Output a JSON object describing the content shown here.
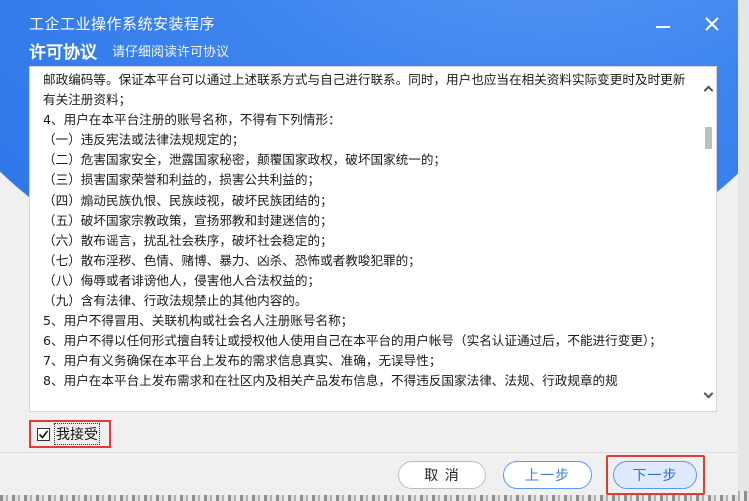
{
  "window": {
    "app_title": "工企工业操作系统安装程序",
    "section_title": "许可协议",
    "section_subtitle": "请仔细阅读许可协议",
    "minimize_symbol": "—",
    "close_symbol": "✕"
  },
  "license": {
    "paragraphs": [
      "邮政编码等。保证本平台可以通过上述联系方式与自己进行联系。同时，用户也应当在相关资料实际变更时及时更新有关注册资料；",
      "4、用户在本平台注册的账号名称，不得有下列情形：",
      "（一）违反宪法或法律法规规定的；",
      "（二）危害国家安全，泄露国家秘密，颠覆国家政权，破坏国家统一的；",
      "（三）损害国家荣誉和利益的，损害公共利益的；",
      "（四）煽动民族仇恨、民族歧视，破坏民族团结的；",
      "（五）破坏国家宗教政策，宣扬邪教和封建迷信的；",
      "（六）散布谣言，扰乱社会秩序，破坏社会稳定的；",
      "（七）散布淫秽、色情、赌博、暴力、凶杀、恐怖或者教唆犯罪的；",
      "（八）侮辱或者诽谤他人，侵害他人合法权益的；",
      "（九）含有法律、行政法规禁止的其他内容的。",
      "5、用户不得冒用、关联机构或社会名人注册账号名称；",
      "6、用户不得以任何形式擅自转让或授权他人使用自己在本平台的用户帐号（实名认证通过后，不能进行变更）；",
      "7、用户有义务确保在本平台上发布的需求信息真实、准确，无误导性；",
      "8、用户在本平台上发布需求和在社区内及相关产品发布信息，不得违反国家法律、法规、行政规章的规"
    ]
  },
  "accept": {
    "label": "我接受",
    "checked": true,
    "check_glyph": "☑"
  },
  "buttons": {
    "cancel": "取 消",
    "prev": "上一步",
    "next": "下一步"
  },
  "colors": {
    "brand_blue": "#3d84f0",
    "highlight_red": "#e23a3a"
  }
}
